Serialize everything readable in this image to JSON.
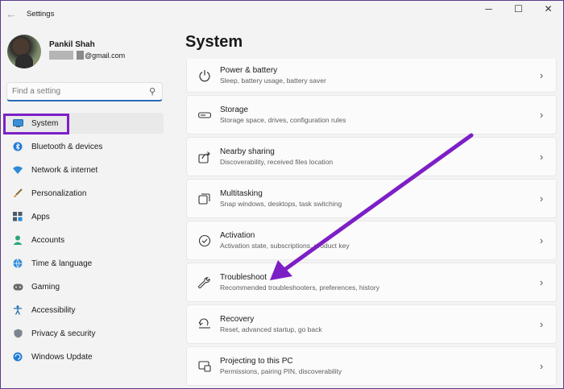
{
  "window": {
    "title": "Settings",
    "back_icon": "back-arrow-icon",
    "minimize": "─",
    "maximize": "☐",
    "close": "✕"
  },
  "profile": {
    "name": "Pankil Shah",
    "email": "@gmail.com"
  },
  "search": {
    "placeholder": "Find a setting"
  },
  "sidebar": {
    "items": [
      {
        "label": "System",
        "icon": "monitor-icon"
      },
      {
        "label": "Bluetooth & devices",
        "icon": "bluetooth-icon"
      },
      {
        "label": "Network & internet",
        "icon": "wifi-icon"
      },
      {
        "label": "Personalization",
        "icon": "paintbrush-icon"
      },
      {
        "label": "Apps",
        "icon": "apps-icon"
      },
      {
        "label": "Accounts",
        "icon": "person-icon"
      },
      {
        "label": "Time & language",
        "icon": "globe-clock-icon"
      },
      {
        "label": "Gaming",
        "icon": "gamepad-icon"
      },
      {
        "label": "Accessibility",
        "icon": "accessibility-icon"
      },
      {
        "label": "Privacy & security",
        "icon": "shield-icon"
      },
      {
        "label": "Windows Update",
        "icon": "update-icon"
      }
    ],
    "selected": "System"
  },
  "main": {
    "title": "System",
    "cards": [
      {
        "title": "Power & battery",
        "desc": "Sleep, battery usage, battery saver",
        "icon": "power-icon"
      },
      {
        "title": "Storage",
        "desc": "Storage space, drives, configuration rules",
        "icon": "storage-icon"
      },
      {
        "title": "Nearby sharing",
        "desc": "Discoverability, received files location",
        "icon": "share-icon"
      },
      {
        "title": "Multitasking",
        "desc": "Snap windows, desktops, task switching",
        "icon": "multitasking-icon"
      },
      {
        "title": "Activation",
        "desc": "Activation state, subscriptions, product key",
        "icon": "checkmark-circle-icon"
      },
      {
        "title": "Troubleshoot",
        "desc": "Recommended troubleshooters, preferences, history",
        "icon": "wrench-icon"
      },
      {
        "title": "Recovery",
        "desc": "Reset, advanced startup, go back",
        "icon": "recovery-icon"
      },
      {
        "title": "Projecting to this PC",
        "desc": "Permissions, pairing PIN, discoverability",
        "icon": "projecting-icon"
      }
    ]
  },
  "colors": {
    "accent": "#2a6ab8",
    "annotation": "#7d1fc7"
  }
}
